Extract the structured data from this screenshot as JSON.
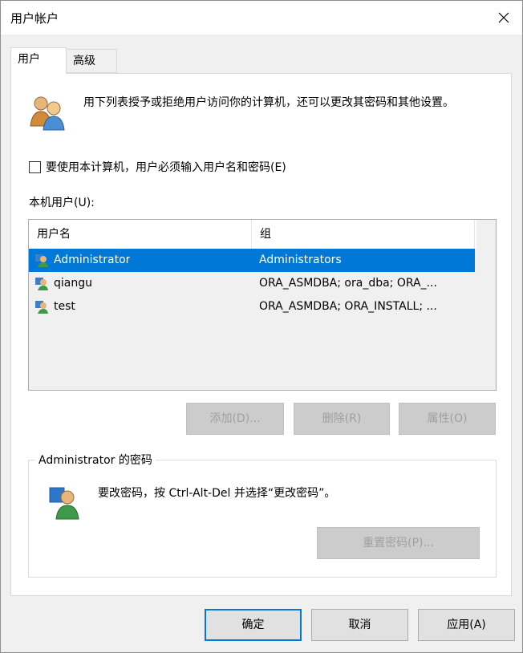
{
  "window": {
    "title": "用户帐户",
    "close_label": "✕"
  },
  "tabs": [
    {
      "label": "用户",
      "active": true
    },
    {
      "label": "高级",
      "active": false
    }
  ],
  "users_tab": {
    "info_text": "用下列表授予或拒绝用户访问你的计算机，还可以更改其密码和其他设置。",
    "require_login_checkbox": {
      "label": "要使用本计算机，用户必须输入用户名和密码(E)",
      "checked": false
    },
    "local_users_label": "本机用户(U):",
    "list": {
      "columns": [
        "用户名",
        "组"
      ],
      "rows": [
        {
          "username": "Administrator",
          "groups": "Administrators",
          "selected": true,
          "icon": "user-account-icon"
        },
        {
          "username": "qiangu",
          "groups": "ORA_ASMDBA; ora_dba; ORA_...",
          "selected": false,
          "icon": "user-account-icon"
        },
        {
          "username": "test",
          "groups": "ORA_ASMDBA; ORA_INSTALL; ...",
          "selected": false,
          "icon": "user-account-icon"
        }
      ]
    },
    "buttons": {
      "add": "添加(D)...",
      "remove": "删除(R)",
      "properties": "属性(O)"
    },
    "password_group": {
      "legend": "Administrator 的密码",
      "text": "要改密码，按 Ctrl-Alt-Del 并选择“更改密码”。",
      "reset_button": "重置密码(P)..."
    }
  },
  "footer": {
    "ok": "确定",
    "cancel": "取消",
    "apply": "应用(A)"
  },
  "colors": {
    "selection": "#0078d7",
    "dialog_bg": "#f0f0f0",
    "panel_bg": "#ffffff"
  }
}
